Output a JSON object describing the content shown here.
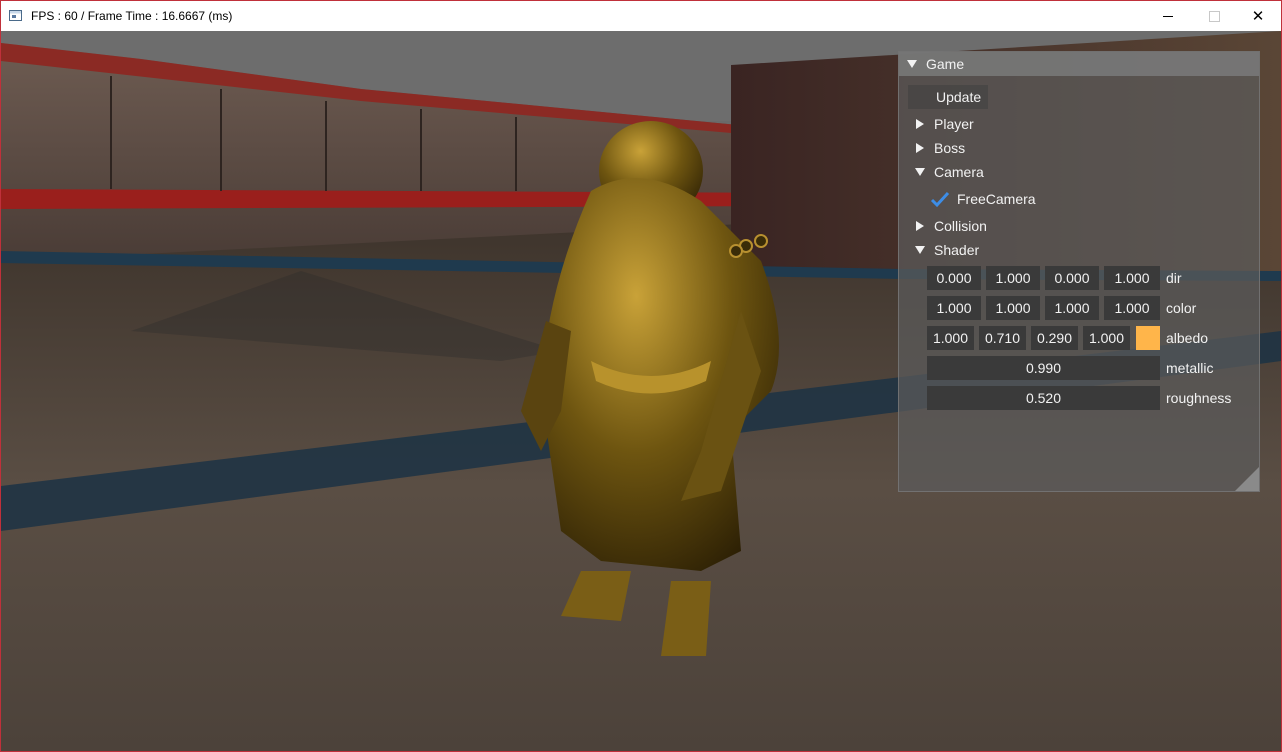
{
  "window": {
    "title": "FPS : 60 / Frame Time : 16.6667 (ms)",
    "frame_color": "#c0303a",
    "controls": {
      "minimize": "—",
      "maximize": "□",
      "close": "✕"
    }
  },
  "scene": {
    "description_icon": "3d-viewport",
    "character_color": "#8a6a12"
  },
  "panel": {
    "title": "Game",
    "update_label": "Update",
    "nodes": {
      "player": "Player",
      "boss": "Boss",
      "camera": "Camera",
      "collision": "Collision",
      "shader": "Shader"
    },
    "free_camera": {
      "label": "FreeCamera",
      "checked": true,
      "check_color": "#3d8de6"
    },
    "shader": {
      "dir": {
        "label": "dir",
        "values": [
          "0.000",
          "1.000",
          "0.000",
          "1.000"
        ]
      },
      "color": {
        "label": "color",
        "values": [
          "1.000",
          "1.000",
          "1.000",
          "1.000"
        ]
      },
      "albedo": {
        "label": "albedo",
        "values": [
          "1.000",
          "0.710",
          "0.290",
          "1.000"
        ],
        "swatch": "#ffb54a"
      },
      "metallic": {
        "label": "metallic",
        "value": "0.990"
      },
      "roughness": {
        "label": "roughness",
        "value": "0.520"
      }
    }
  }
}
